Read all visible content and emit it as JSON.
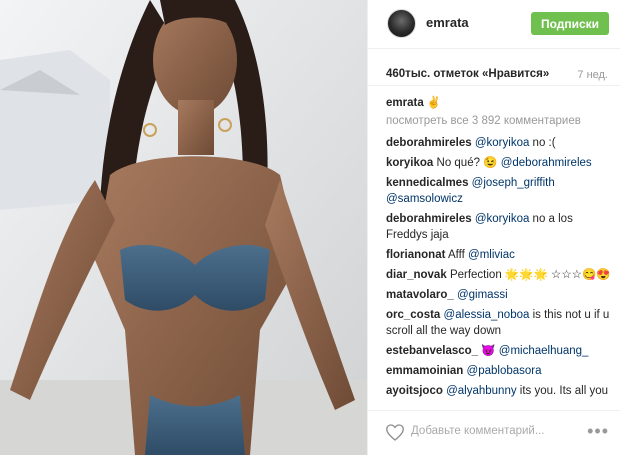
{
  "header": {
    "username": "emrata",
    "follow_label": "Подписки",
    "follow_color": "#70c050"
  },
  "likes_row": {
    "likes": "460тыс. отметок «Нравится»",
    "time": "7 нед."
  },
  "caption": {
    "user": "emrata",
    "text": "✌"
  },
  "view_all": "посмотреть все 3 892 комментариев",
  "comments": [
    {
      "user": "deborahmireles",
      "text": "@koryikoa no :("
    },
    {
      "user": "koryikoa",
      "text": "No qué? 😉 @deborahmireles"
    },
    {
      "user": "kennedicalmes",
      "text": "@joseph_griffith @samsolowicz"
    },
    {
      "user": "deborahmireles",
      "text": "@koryikoa no a los Freddys jaja"
    },
    {
      "user": "florianonat",
      "text": "Afff @mliviac"
    },
    {
      "user": "diar_novak",
      "text": "Perfection 🌟🌟🌟 ☆☆☆😋😍"
    },
    {
      "user": "matavolaro_",
      "text": "@gimassi"
    },
    {
      "user": "orc_costa",
      "text": "@alessia_noboa is this not u if u scroll all the way down"
    },
    {
      "user": "estebanvelasco_",
      "text": "😈 @michaelhuang_"
    },
    {
      "user": "emmamoinian",
      "text": "@pablobasora"
    },
    {
      "user": "ayoitsjoco",
      "text": "@alyahbunny its you. Its all you"
    }
  ],
  "footer": {
    "add_comment_placeholder": "Добавьте комментарий...",
    "more_icon": "more-icon",
    "like_icon": "heart-icon"
  }
}
